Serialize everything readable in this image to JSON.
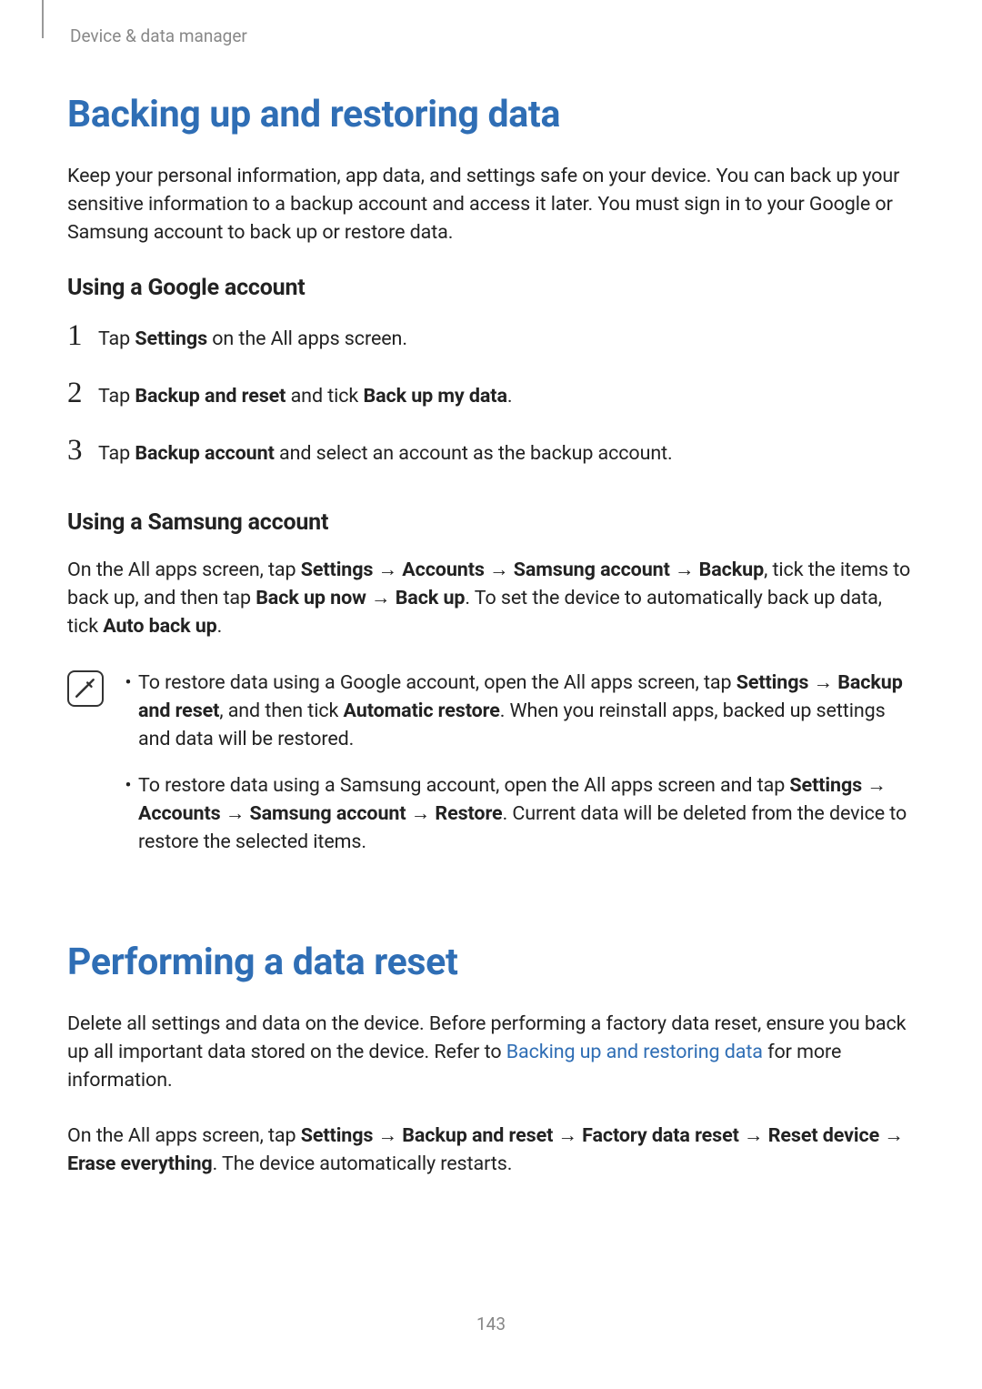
{
  "breadcrumb": "Device & data manager",
  "section1": {
    "title": "Backing up and restoring data",
    "intro": "Keep your personal information, app data, and settings safe on your device. You can back up your sensitive information to a backup account and access it later. You must sign in to your Google or Samsung account to back up or restore data.",
    "sub1": {
      "heading": "Using a Google account",
      "steps": {
        "s1_pre": "Tap ",
        "s1_b1": "Settings",
        "s1_post": " on the All apps screen.",
        "s2_pre": "Tap ",
        "s2_b1": "Backup and reset",
        "s2_mid": " and tick ",
        "s2_b2": "Back up my data",
        "s2_post": ".",
        "s3_pre": "Tap ",
        "s3_b1": "Backup account",
        "s3_post": " and select an account as the backup account."
      }
    },
    "sub2": {
      "heading": "Using a Samsung account",
      "para_pre": "On the All apps screen, tap ",
      "para_b1": "Settings",
      "para_arr1": " → ",
      "para_b2": "Accounts",
      "para_arr2": " → ",
      "para_b3": "Samsung account",
      "para_arr3": " → ",
      "para_b4": "Backup",
      "para_mid1": ", tick the items to back up, and then tap ",
      "para_b5": "Back up now",
      "para_arr4": " → ",
      "para_b6": "Back up",
      "para_mid2": ". To set the device to automatically back up data, tick ",
      "para_b7": "Auto back up",
      "para_post": ".",
      "note": {
        "bullet1_pre": "To restore data using a Google account, open the All apps screen, tap ",
        "bullet1_b1": "Settings",
        "bullet1_arr1": " → ",
        "bullet1_b2": "Backup and reset",
        "bullet1_mid": ", and then tick ",
        "bullet1_b3": "Automatic restore",
        "bullet1_post": ". When you reinstall apps, backed up settings and data will be restored.",
        "bullet2_pre": "To restore data using a Samsung account, open the All apps screen and tap ",
        "bullet2_b1": "Settings",
        "bullet2_arr1": " → ",
        "bullet2_b2": "Accounts",
        "bullet2_arr2": " → ",
        "bullet2_b3": "Samsung account",
        "bullet2_arr3": " → ",
        "bullet2_b4": "Restore",
        "bullet2_post": ". Current data will be deleted from the device to restore the selected items."
      }
    }
  },
  "section2": {
    "title": "Performing a data reset",
    "para1_pre": "Delete all settings and data on the device. Before performing a factory data reset, ensure you back up all important data stored on the device. Refer to ",
    "para1_link": "Backing up and restoring data",
    "para1_post": " for more information.",
    "para2_pre": "On the All apps screen, tap ",
    "para2_b1": "Settings",
    "para2_arr1": " → ",
    "para2_b2": "Backup and reset",
    "para2_arr2": " → ",
    "para2_b3": "Factory data reset",
    "para2_arr3": " → ",
    "para2_b4": "Reset device",
    "para2_arr4": " → ",
    "para2_b5": "Erase everything",
    "para2_post": ". The device automatically restarts."
  },
  "page_number": "143",
  "nums": {
    "n1": "1",
    "n2": "2",
    "n3": "3"
  },
  "bullet": "•"
}
